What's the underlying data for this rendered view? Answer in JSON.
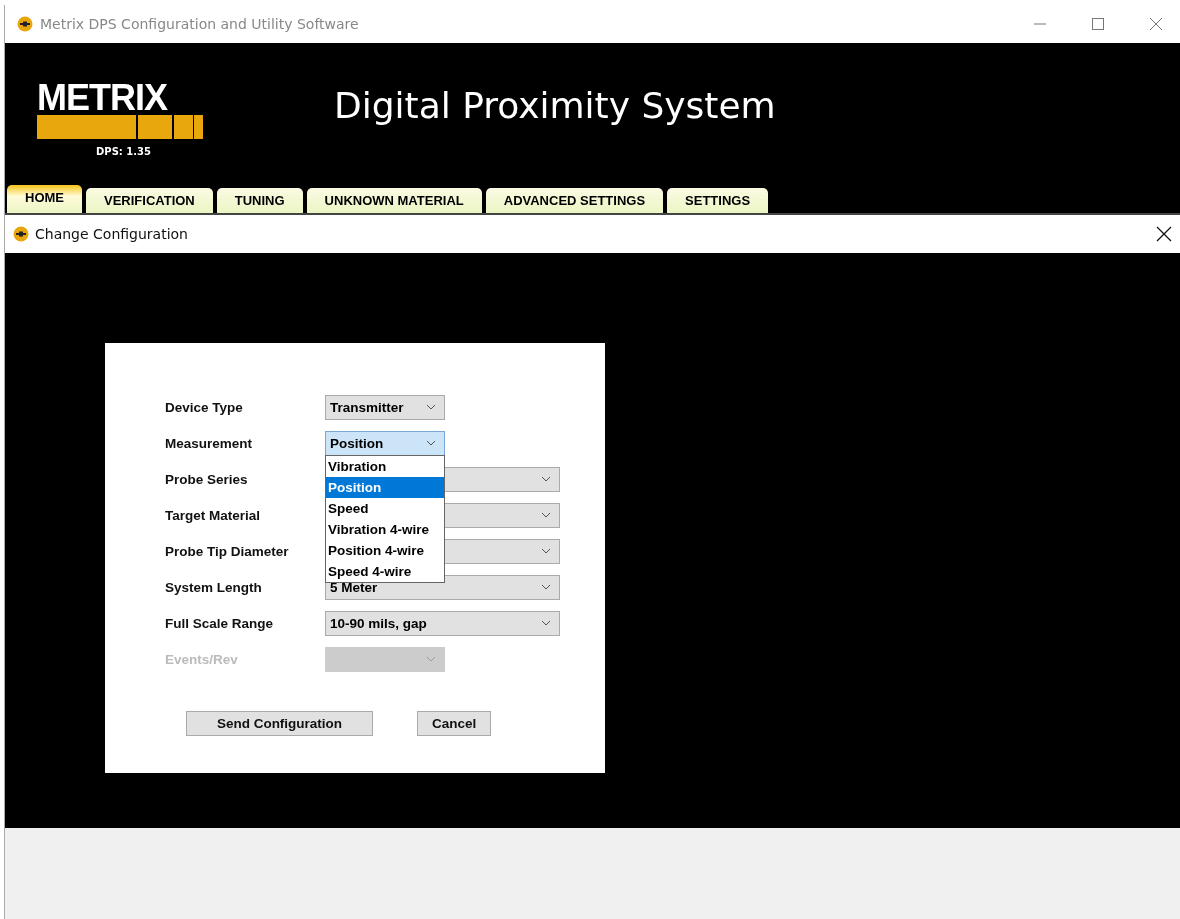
{
  "window": {
    "title": "Metrix DPS Configuration and Utility Software"
  },
  "header": {
    "logo": "METRIX",
    "version": "DPS: 1.35",
    "title": "Digital Proximity System"
  },
  "tabs": [
    {
      "label": "HOME",
      "selected": true
    },
    {
      "label": "VERIFICATION",
      "selected": false
    },
    {
      "label": "TUNING",
      "selected": false
    },
    {
      "label": "UNKNOWN MATERIAL",
      "selected": false
    },
    {
      "label": "ADVANCED SETTINGS",
      "selected": false
    },
    {
      "label": "SETTINGS",
      "selected": false
    }
  ],
  "dialog": {
    "title": "Change Configuration",
    "fields": [
      {
        "label": "Device Type",
        "value": "Transmitter",
        "kind": "short",
        "disabled": false,
        "open": false
      },
      {
        "label": "Measurement",
        "value": "Position",
        "kind": "short",
        "disabled": false,
        "open": true,
        "options": [
          {
            "label": "Vibration",
            "selected": false
          },
          {
            "label": "Position",
            "selected": true
          },
          {
            "label": "Speed",
            "selected": false
          },
          {
            "label": "Vibration 4-wire",
            "selected": false
          },
          {
            "label": "Position 4-wire",
            "selected": false
          },
          {
            "label": "Speed 4-wire",
            "selected": false
          }
        ]
      },
      {
        "label": "Probe Series",
        "kind": "long",
        "disabled": false,
        "open": false
      },
      {
        "label": "Target Material",
        "kind": "long",
        "disabled": false,
        "open": false
      },
      {
        "label": "Probe Tip Diameter",
        "kind": "long",
        "disabled": false,
        "open": false
      },
      {
        "label": "System Length",
        "value": "5 Meter",
        "kind": "long",
        "disabled": false,
        "open": false
      },
      {
        "label": "Full Scale Range",
        "value": "10-90 mils, gap",
        "kind": "long",
        "disabled": false,
        "open": false
      },
      {
        "label": "Events/Rev",
        "kind": "short",
        "disabled": true,
        "open": false
      }
    ],
    "buttons": [
      "Send Configuration",
      "Cancel"
    ]
  }
}
